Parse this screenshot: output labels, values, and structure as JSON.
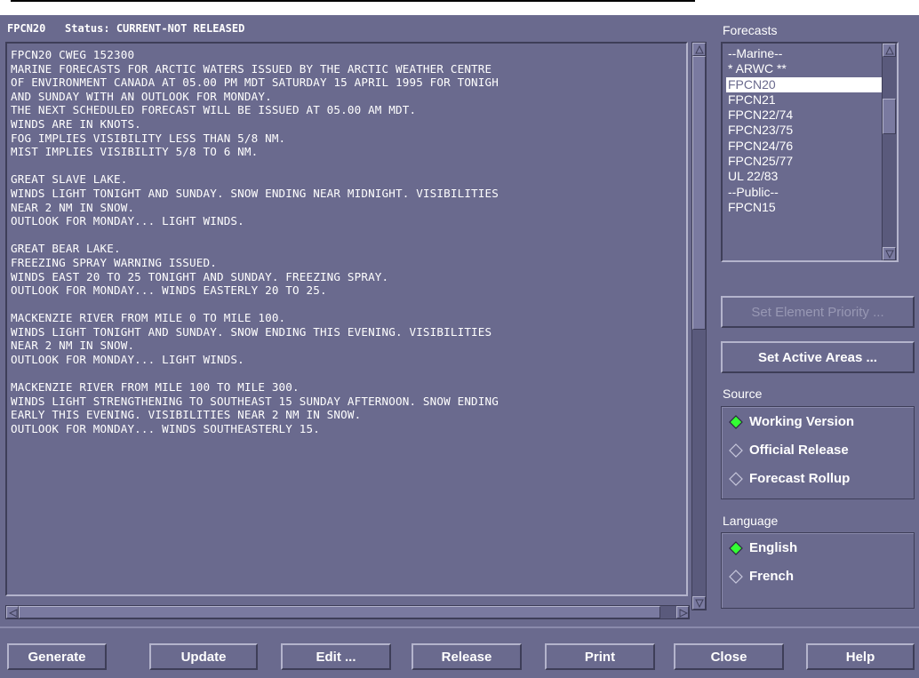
{
  "window": {
    "title": "FPCN20   Status: CURRENT-NOT RELEASED"
  },
  "text_content": [
    "FPCN20 CWEG 152300",
    "MARINE FORECASTS FOR ARCTIC WATERS ISSUED BY THE ARCTIC WEATHER CENTRE",
    "OF ENVIRONMENT CANADA AT 05.00 PM MDT SATURDAY 15 APRIL 1995 FOR TONIGH",
    "AND SUNDAY WITH AN OUTLOOK FOR MONDAY.",
    "THE NEXT SCHEDULED FORECAST WILL BE ISSUED AT 05.00 AM MDT.",
    "WINDS ARE IN KNOTS.",
    "FOG IMPLIES VISIBILITY LESS THAN 5/8 NM.",
    "MIST IMPLIES VISIBILITY 5/8 TO 6 NM.",
    "",
    "GREAT SLAVE LAKE.",
    "WINDS LIGHT TONIGHT AND SUNDAY. SNOW ENDING NEAR MIDNIGHT. VISIBILITIES",
    "NEAR 2 NM IN SNOW.",
    "OUTLOOK FOR MONDAY... LIGHT WINDS.",
    "",
    "GREAT BEAR LAKE.",
    "FREEZING SPRAY WARNING ISSUED.",
    "WINDS EAST 20 TO 25 TONIGHT AND SUNDAY. FREEZING SPRAY.",
    "OUTLOOK FOR MONDAY... WINDS EASTERLY 20 TO 25.",
    "",
    "MACKENZIE RIVER FROM MILE 0 TO MILE 100.",
    "WINDS LIGHT TONIGHT AND SUNDAY. SNOW ENDING THIS EVENING. VISIBILITIES",
    "NEAR 2 NM IN SNOW.",
    "OUTLOOK FOR MONDAY... LIGHT WINDS.",
    "",
    "MACKENZIE RIVER FROM MILE 100 TO MILE 300.",
    "WINDS LIGHT STRENGTHENING TO SOUTHEAST 15 SUNDAY AFTERNOON. SNOW ENDING",
    "EARLY THIS EVENING. VISIBILITIES NEAR 2 NM IN SNOW.",
    "OUTLOOK FOR MONDAY... WINDS SOUTHEASTERLY 15."
  ],
  "forecasts": {
    "label": "Forecasts",
    "items": [
      {
        "label": "--Marine--",
        "selected": false
      },
      {
        "label": "* ARWC **",
        "selected": false
      },
      {
        "label": "FPCN20",
        "selected": true
      },
      {
        "label": "FPCN21",
        "selected": false
      },
      {
        "label": "FPCN22/74",
        "selected": false
      },
      {
        "label": "FPCN23/75",
        "selected": false
      },
      {
        "label": "FPCN24/76",
        "selected": false
      },
      {
        "label": "FPCN25/77",
        "selected": false
      },
      {
        "label": "UL 22/83",
        "selected": false
      },
      {
        "label": "--Public--",
        "selected": false
      },
      {
        "label": "FPCN15",
        "selected": false
      }
    ]
  },
  "buttons": {
    "set_element_priority": "Set Element Priority ...",
    "set_active_areas": "Set Active Areas ..."
  },
  "source": {
    "label": "Source",
    "options": [
      {
        "label": "Working Version",
        "selected": true
      },
      {
        "label": "Official Release",
        "selected": false
      },
      {
        "label": "Forecast Rollup",
        "selected": false
      }
    ]
  },
  "language": {
    "label": "Language",
    "options": [
      {
        "label": "English",
        "selected": true
      },
      {
        "label": "French",
        "selected": false
      }
    ]
  },
  "bottom_buttons": [
    {
      "id": "generate",
      "label": "Generate"
    },
    {
      "id": "update",
      "label": "Update"
    },
    {
      "id": "edit",
      "label": "Edit ..."
    },
    {
      "id": "release",
      "label": "Release"
    },
    {
      "id": "print",
      "label": "Print"
    },
    {
      "id": "close",
      "label": "Close"
    },
    {
      "id": "help",
      "label": "Help"
    }
  ],
  "colors": {
    "background": "#6a6a8e",
    "selected_radio": "#33ff33",
    "text": "#ffffff"
  }
}
